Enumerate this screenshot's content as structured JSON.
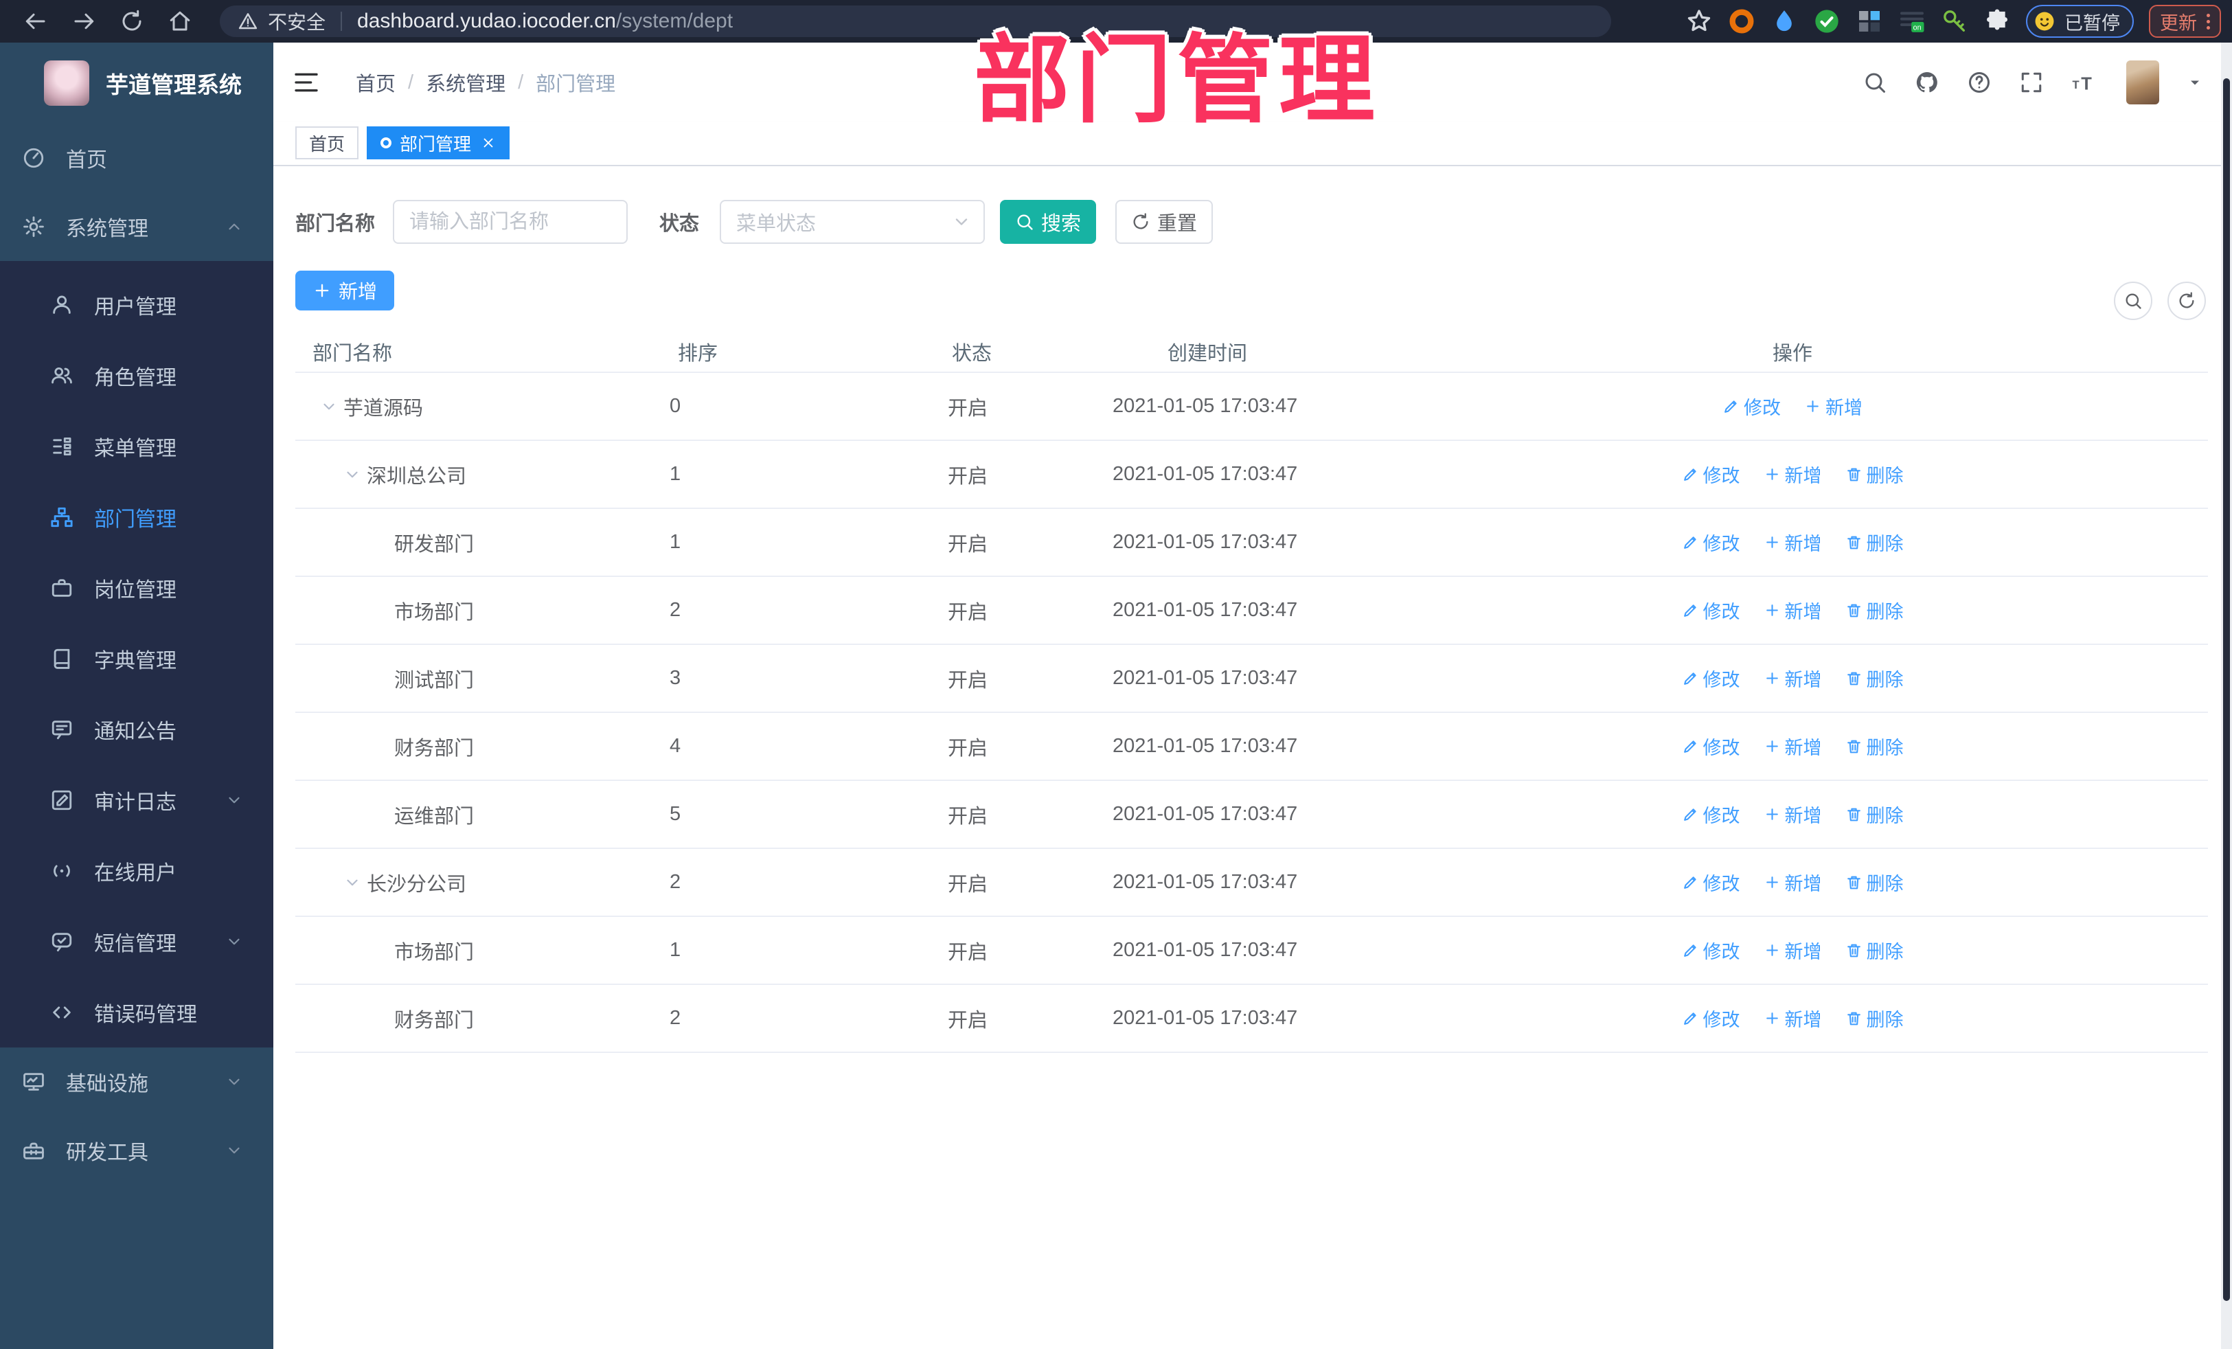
{
  "watermark": "部门管理",
  "browser": {
    "security": "不安全",
    "url_host": "dashboard.yudao.iocoder.cn",
    "url_path": "/system/dept",
    "paused": "已暂停",
    "update": "更新",
    "extensions": [
      "orange-ring-icon",
      "blue-drop-icon",
      "green-check-icon",
      "grid-icon",
      "list-on-icon",
      "key-icon",
      "puzzle-icon"
    ]
  },
  "sidebar": {
    "title": "芋道管理系统",
    "menu": [
      {
        "label": "首页",
        "icon": "dashboard-icon",
        "type": "top"
      },
      {
        "label": "系统管理",
        "icon": "gear-icon",
        "type": "top",
        "arrow": "up"
      },
      {
        "label": "用户管理",
        "icon": "user-icon",
        "type": "sub"
      },
      {
        "label": "角色管理",
        "icon": "users-icon",
        "type": "sub"
      },
      {
        "label": "菜单管理",
        "icon": "menu-tree-icon",
        "type": "sub"
      },
      {
        "label": "部门管理",
        "icon": "org-icon",
        "type": "sub",
        "active": true
      },
      {
        "label": "岗位管理",
        "icon": "briefcase-icon",
        "type": "sub"
      },
      {
        "label": "字典管理",
        "icon": "book-icon",
        "type": "sub"
      },
      {
        "label": "通知公告",
        "icon": "notice-icon",
        "type": "sub"
      },
      {
        "label": "审计日志",
        "icon": "audit-icon",
        "type": "sub",
        "arrow": "down"
      },
      {
        "label": "在线用户",
        "icon": "online-icon",
        "type": "sub"
      },
      {
        "label": "短信管理",
        "icon": "sms-icon",
        "type": "sub",
        "arrow": "down"
      },
      {
        "label": "错误码管理",
        "icon": "code-icon",
        "type": "sub"
      },
      {
        "label": "基础设施",
        "icon": "monitor-icon",
        "type": "top",
        "arrow": "down"
      },
      {
        "label": "研发工具",
        "icon": "toolbox-icon",
        "type": "top",
        "arrow": "down"
      }
    ]
  },
  "navbar": {
    "breadcrumb": [
      "首页",
      "系统管理",
      "部门管理"
    ]
  },
  "tabs": [
    {
      "label": "首页",
      "active": false
    },
    {
      "label": "部门管理",
      "active": true,
      "closable": true
    }
  ],
  "filter": {
    "name_label": "部门名称",
    "name_placeholder": "请输入部门名称",
    "status_label": "状态",
    "status_placeholder": "菜单状态",
    "search_label": "搜索",
    "reset_label": "重置"
  },
  "toolbar": {
    "add_label": "新增"
  },
  "table": {
    "headers": [
      "部门名称",
      "排序",
      "状态",
      "创建时间",
      "操作"
    ],
    "action_labels": {
      "edit": "修改",
      "add": "新增",
      "delete": "删除"
    },
    "rows": [
      {
        "name": "芋道源码",
        "level": 0,
        "expandable": true,
        "sort": "0",
        "status": "开启",
        "time": "2021-01-05 17:03:47",
        "actions": [
          "edit",
          "add"
        ]
      },
      {
        "name": "深圳总公司",
        "level": 1,
        "expandable": true,
        "sort": "1",
        "status": "开启",
        "time": "2021-01-05 17:03:47",
        "actions": [
          "edit",
          "add",
          "delete"
        ]
      },
      {
        "name": "研发部门",
        "level": 2,
        "expandable": false,
        "sort": "1",
        "status": "开启",
        "time": "2021-01-05 17:03:47",
        "actions": [
          "edit",
          "add",
          "delete"
        ]
      },
      {
        "name": "市场部门",
        "level": 2,
        "expandable": false,
        "sort": "2",
        "status": "开启",
        "time": "2021-01-05 17:03:47",
        "actions": [
          "edit",
          "add",
          "delete"
        ]
      },
      {
        "name": "测试部门",
        "level": 2,
        "expandable": false,
        "sort": "3",
        "status": "开启",
        "time": "2021-01-05 17:03:47",
        "actions": [
          "edit",
          "add",
          "delete"
        ]
      },
      {
        "name": "财务部门",
        "level": 2,
        "expandable": false,
        "sort": "4",
        "status": "开启",
        "time": "2021-01-05 17:03:47",
        "actions": [
          "edit",
          "add",
          "delete"
        ]
      },
      {
        "name": "运维部门",
        "level": 2,
        "expandable": false,
        "sort": "5",
        "status": "开启",
        "time": "2021-01-05 17:03:47",
        "actions": [
          "edit",
          "add",
          "delete"
        ]
      },
      {
        "name": "长沙分公司",
        "level": 1,
        "expandable": true,
        "sort": "2",
        "status": "开启",
        "time": "2021-01-05 17:03:47",
        "actions": [
          "edit",
          "add",
          "delete"
        ]
      },
      {
        "name": "市场部门",
        "level": 2,
        "expandable": false,
        "sort": "1",
        "status": "开启",
        "time": "2021-01-05 17:03:47",
        "actions": [
          "edit",
          "add",
          "delete"
        ]
      },
      {
        "name": "财务部门",
        "level": 2,
        "expandable": false,
        "sort": "2",
        "status": "开启",
        "time": "2021-01-05 17:03:47",
        "actions": [
          "edit",
          "add",
          "delete"
        ]
      }
    ]
  }
}
